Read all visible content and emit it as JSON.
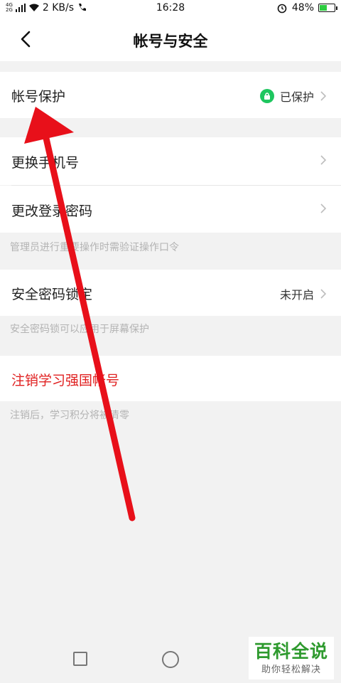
{
  "status_bar": {
    "net_top": "4G",
    "net_bottom": "2G",
    "speed": "2 KB/s",
    "time": "16:28",
    "battery": "48%",
    "battery_level": 0.48,
    "battery_color": "#2ecc40"
  },
  "header": {
    "title": "帐号与安全",
    "back_icon": "chevron-left-icon"
  },
  "sections": {
    "account_protection": {
      "label": "帐号保护",
      "status": "已保护"
    },
    "change_phone": {
      "label": "更换手机号",
      "value": ""
    },
    "change_password": {
      "label": "更改登录密码"
    },
    "admin_hint": "管理员进行重要操作时需验证操作口令",
    "security_lock": {
      "label": "安全密码锁定",
      "status": "未开启"
    },
    "lock_hint": "安全密码锁可以应用于屏幕保护",
    "deactivate": {
      "label": "注销学习强国帐号"
    },
    "deactivate_hint": "注销后，学习积分将被清零"
  },
  "watermark": {
    "title": "百科全说",
    "subtitle": "助你轻松解决"
  },
  "colors": {
    "accent_green": "#1ec65f",
    "danger_red": "#e02020",
    "arrow_red": "#e8101a"
  }
}
